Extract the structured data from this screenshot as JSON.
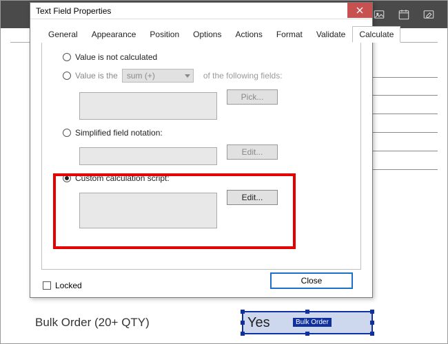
{
  "toolbar_icons": [
    "image-icon",
    "calendar-icon",
    "edit-icon"
  ],
  "dialog": {
    "title": "Text Field Properties",
    "tabs": [
      "General",
      "Appearance",
      "Position",
      "Options",
      "Actions",
      "Format",
      "Validate",
      "Calculate"
    ],
    "active_tab": "Calculate",
    "radios": {
      "not_calculated": "Value is not calculated",
      "value_is_the": "Value is the",
      "sum_option": "sum (+)",
      "of_fields": "of the following fields:",
      "simplified": "Simplified field notation:",
      "custom": "Custom calculation script:"
    },
    "buttons": {
      "pick": "Pick...",
      "edit1": "Edit...",
      "edit2": "Edit..."
    },
    "locked": "Locked",
    "close": "Close"
  },
  "page": {
    "bulk_label": "Bulk Order (20+ QTY)",
    "field_value": "Yes",
    "field_tag": "Bulk Order"
  }
}
